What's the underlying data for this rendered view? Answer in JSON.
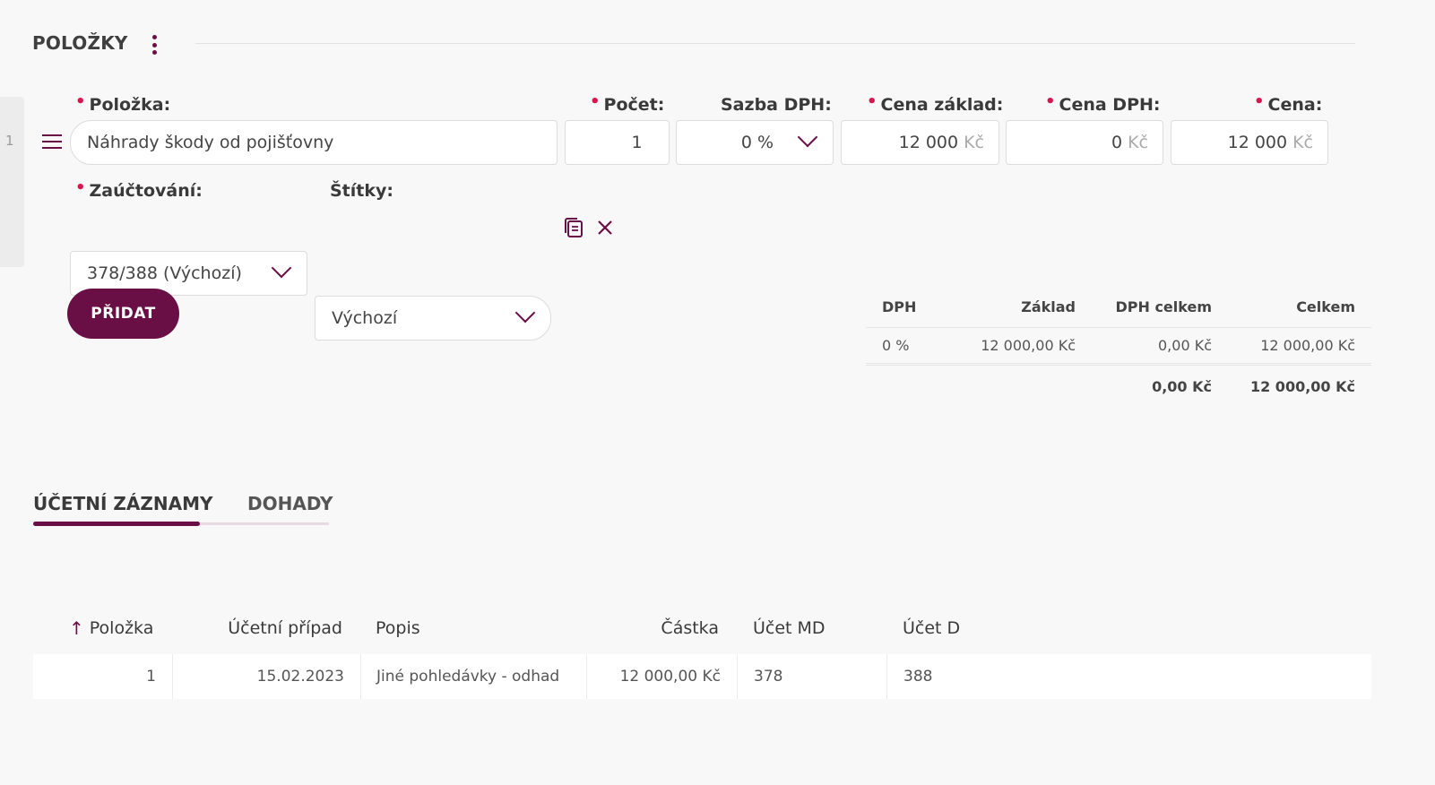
{
  "section": {
    "title": "POLOŽKY"
  },
  "row": {
    "number": "1"
  },
  "labels": {
    "polozka": "Položka:",
    "pocet": "Počet:",
    "sazba_dph": "Sazba DPH:",
    "cena_zaklad": "Cena základ:",
    "cena_dph": "Cena DPH:",
    "cena": "Cena:",
    "zauctovani": "Zaúčtování:",
    "stitky": "Štítky:"
  },
  "fields": {
    "polozka": "Náhrady škody od pojišťovny",
    "pocet": "1",
    "sazba_dph": "0 %",
    "cena_zaklad": "12 000",
    "cena_dph": "0",
    "cena": "12 000",
    "unit": "Kč",
    "zauctovani": "378/388 (Výchozí)",
    "stitky": "Výchozí"
  },
  "buttons": {
    "add": "PŘIDAT"
  },
  "summary": {
    "headers": [
      "DPH",
      "Základ",
      "DPH celkem",
      "Celkem"
    ],
    "rows": [
      [
        "0 %",
        "12 000,00 Kč",
        "0,00 Kč",
        "12 000,00 Kč"
      ]
    ],
    "totals": [
      "",
      "",
      "0,00 Kč",
      "12 000,00 Kč"
    ]
  },
  "tabs": [
    {
      "label": "ÚČETNÍ ZÁZNAMY",
      "active": true
    },
    {
      "label": "DOHADY",
      "active": false
    }
  ],
  "records": {
    "sort_indicator": "↑",
    "headers": [
      "Položka",
      "Účetní případ",
      "Popis",
      "Částka",
      "Účet MD",
      "Účet D"
    ],
    "rows": [
      [
        "1",
        "15.02.2023",
        "Jiné pohledávky - odhad",
        "12 000,00 Kč",
        "378",
        "388"
      ]
    ]
  },
  "colors": {
    "accent": "#6a0f45",
    "required": "#d8154f"
  },
  "icons": {
    "menu": "kebab-icon",
    "drag": "drag-handle-icon",
    "copy": "copy-icon",
    "close": "close-icon",
    "dropdown": "chevron-down-icon",
    "sort": "arrow-up-icon"
  }
}
